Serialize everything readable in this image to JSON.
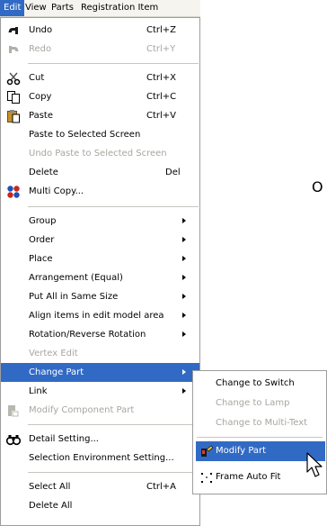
{
  "menubar": {
    "items": [
      {
        "label": "Edit"
      },
      {
        "label": "View"
      },
      {
        "label": "Parts"
      },
      {
        "label": "Registration Item"
      }
    ]
  },
  "background_text": "O",
  "edit_menu": {
    "items": [
      {
        "label": "Undo",
        "shortcut": "Ctrl+Z",
        "icon": "undo-icon"
      },
      {
        "label": "Redo",
        "shortcut": "Ctrl+Y",
        "icon": "redo-icon",
        "disabled": true
      },
      {
        "label": "Cut",
        "shortcut": "Ctrl+X",
        "icon": "scissors-icon"
      },
      {
        "label": "Copy",
        "shortcut": "Ctrl+C",
        "icon": "copy-icon"
      },
      {
        "label": "Paste",
        "shortcut": "Ctrl+V",
        "icon": "paste-icon"
      },
      {
        "label": "Paste to Selected Screen"
      },
      {
        "label": "Undo Paste to Selected Screen",
        "disabled": true
      },
      {
        "label": "Delete",
        "shortcut": "Del"
      },
      {
        "label": "Multi Copy...",
        "icon": "multi-copy-icon"
      },
      {
        "label": "Group"
      },
      {
        "label": "Order"
      },
      {
        "label": "Place"
      },
      {
        "label": "Arrangement (Equal)"
      },
      {
        "label": "Put All in Same Size"
      },
      {
        "label": "Align items in edit model area"
      },
      {
        "label": "Rotation/Reverse Rotation"
      },
      {
        "label": "Vertex Edit",
        "disabled": true
      },
      {
        "label": "Change Part",
        "highlighted": true
      },
      {
        "label": "Link"
      },
      {
        "label": "Modify Component Part",
        "icon": "component-icon",
        "disabled": true
      },
      {
        "label": "Detail Setting...",
        "icon": "binoculars-icon"
      },
      {
        "label": "Selection Environment Setting..."
      },
      {
        "label": "Select All",
        "shortcut": "Ctrl+A"
      },
      {
        "label": "Delete All"
      }
    ]
  },
  "change_part_submenu": {
    "items": [
      {
        "label": "Change to Switch"
      },
      {
        "label": "Change to Lamp",
        "disabled": true
      },
      {
        "label": "Change to Multi-Text",
        "disabled": true
      },
      {
        "label": "Modify Part",
        "icon": "modify-part-icon",
        "highlighted": true
      },
      {
        "label": "Frame Auto Fit",
        "icon": "frame-fit-icon"
      }
    ]
  },
  "colors": {
    "highlight": "#316ac5",
    "disabled_text": "#a7a6a0",
    "menubar_bg": "#f5f4ee"
  }
}
